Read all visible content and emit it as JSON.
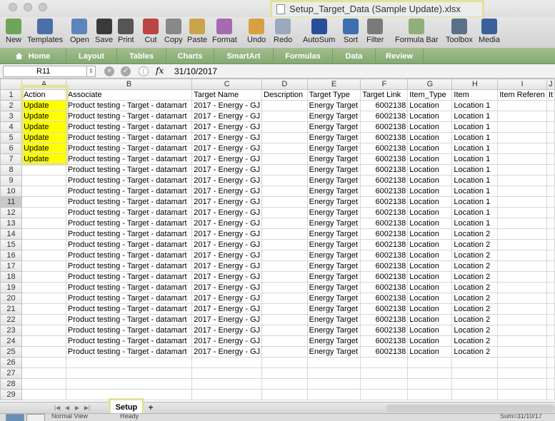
{
  "window": {
    "title": "Setup_Target_Data (Sample Update).xlsx"
  },
  "toolbar": {
    "buttons": [
      {
        "label": "New",
        "icon": "new-document-icon"
      },
      {
        "label": "Templates",
        "icon": "templates-icon"
      },
      {
        "label": "Open",
        "icon": "open-folder-icon"
      },
      {
        "label": "Save",
        "icon": "save-icon"
      },
      {
        "label": "Print",
        "icon": "print-icon"
      },
      {
        "label": "Cut",
        "icon": "scissors-icon"
      },
      {
        "label": "Copy",
        "icon": "copy-icon"
      },
      {
        "label": "Paste",
        "icon": "paste-icon"
      },
      {
        "label": "Format",
        "icon": "format-brush-icon"
      },
      {
        "label": "Undo",
        "icon": "undo-icon"
      },
      {
        "label": "Redo",
        "icon": "redo-icon"
      },
      {
        "label": "AutoSum",
        "icon": "sigma-icon"
      },
      {
        "label": "Sort",
        "icon": "sort-icon"
      },
      {
        "label": "Filter",
        "icon": "filter-icon"
      },
      {
        "label": "Formula Bar",
        "icon": "fx-icon"
      },
      {
        "label": "Toolbox",
        "icon": "toolbox-icon"
      },
      {
        "label": "Media",
        "icon": "media-icon"
      }
    ]
  },
  "ribbon": {
    "tabs": [
      "Home",
      "Layout",
      "Tables",
      "Charts",
      "SmartArt",
      "Formulas",
      "Data",
      "Review"
    ]
  },
  "formula_bar": {
    "name_box": "R11",
    "fx_label": "fx",
    "value": "31/10/2017"
  },
  "sheet": {
    "column_letters": [
      "A",
      "B",
      "C",
      "D",
      "E",
      "F",
      "G",
      "H",
      "I",
      "J"
    ],
    "header_row": [
      "Action",
      "Associate",
      "Target Name",
      "Description",
      "Target Type",
      "Target Link",
      "Item_Type",
      "Item",
      "Item Referen",
      "It"
    ],
    "selected_row": 11,
    "rows": [
      [
        "Update",
        "Product testing - Target - datamart",
        "2017 - Energy - GJ",
        "",
        "Energy Target",
        "6002138",
        "Location",
        "Location 1"
      ],
      [
        "Update",
        "Product testing - Target - datamart",
        "2017 - Energy - GJ",
        "",
        "Energy Target",
        "6002138",
        "Location",
        "Location 1"
      ],
      [
        "Update",
        "Product testing - Target - datamart",
        "2017 - Energy - GJ",
        "",
        "Energy Target",
        "6002138",
        "Location",
        "Location 1"
      ],
      [
        "Update",
        "Product testing - Target - datamart",
        "2017 - Energy - GJ",
        "",
        "Energy Target",
        "6002138",
        "Location",
        "Location 1"
      ],
      [
        "Update",
        "Product testing - Target - datamart",
        "2017 - Energy - GJ",
        "",
        "Energy Target",
        "6002138",
        "Location",
        "Location 1"
      ],
      [
        "Update",
        "Product testing - Target - datamart",
        "2017 - Energy - GJ",
        "",
        "Energy Target",
        "6002138",
        "Location",
        "Location 1"
      ],
      [
        "",
        "Product testing - Target - datamart",
        "2017 - Energy - GJ",
        "",
        "Energy Target",
        "6002138",
        "Location",
        "Location 1"
      ],
      [
        "",
        "Product testing - Target - datamart",
        "2017 - Energy - GJ",
        "",
        "Energy Target",
        "6002138",
        "Location",
        "Location 1"
      ],
      [
        "",
        "Product testing - Target - datamart",
        "2017 - Energy - GJ",
        "",
        "Energy Target",
        "6002138",
        "Location",
        "Location 1"
      ],
      [
        "",
        "Product testing - Target - datamart",
        "2017 - Energy - GJ",
        "",
        "Energy Target",
        "6002138",
        "Location",
        "Location 1"
      ],
      [
        "",
        "Product testing - Target - datamart",
        "2017 - Energy - GJ",
        "",
        "Energy Target",
        "6002138",
        "Location",
        "Location 1"
      ],
      [
        "",
        "Product testing - Target - datamart",
        "2017 - Energy - GJ",
        "",
        "Energy Target",
        "6002138",
        "Location",
        "Location 1"
      ],
      [
        "",
        "Product testing - Target - datamart",
        "2017 - Energy - GJ",
        "",
        "Energy Target",
        "6002138",
        "Location",
        "Location 2"
      ],
      [
        "",
        "Product testing - Target - datamart",
        "2017 - Energy - GJ",
        "",
        "Energy Target",
        "6002138",
        "Location",
        "Location 2"
      ],
      [
        "",
        "Product testing - Target - datamart",
        "2017 - Energy - GJ",
        "",
        "Energy Target",
        "6002138",
        "Location",
        "Location 2"
      ],
      [
        "",
        "Product testing - Target - datamart",
        "2017 - Energy - GJ",
        "",
        "Energy Target",
        "6002138",
        "Location",
        "Location 2"
      ],
      [
        "",
        "Product testing - Target - datamart",
        "2017 - Energy - GJ",
        "",
        "Energy Target",
        "6002138",
        "Location",
        "Location 2"
      ],
      [
        "",
        "Product testing - Target - datamart",
        "2017 - Energy - GJ",
        "",
        "Energy Target",
        "6002138",
        "Location",
        "Location 2"
      ],
      [
        "",
        "Product testing - Target - datamart",
        "2017 - Energy - GJ",
        "",
        "Energy Target",
        "6002138",
        "Location",
        "Location 2"
      ],
      [
        "",
        "Product testing - Target - datamart",
        "2017 - Energy - GJ",
        "",
        "Energy Target",
        "6002138",
        "Location",
        "Location 2"
      ],
      [
        "",
        "Product testing - Target - datamart",
        "2017 - Energy - GJ",
        "",
        "Energy Target",
        "6002138",
        "Location",
        "Location 2"
      ],
      [
        "",
        "Product testing - Target - datamart",
        "2017 - Energy - GJ",
        "",
        "Energy Target",
        "6002138",
        "Location",
        "Location 2"
      ],
      [
        "",
        "Product testing - Target - datamart",
        "2017 - Energy - GJ",
        "",
        "Energy Target",
        "6002138",
        "Location",
        "Location 2"
      ],
      [
        "",
        "Product testing - Target - datamart",
        "2017 - Energy - GJ",
        "",
        "Energy Target",
        "6002138",
        "Location",
        "Location 2"
      ]
    ],
    "empty_rows": 4
  },
  "sheet_tabs": {
    "active": "Setup",
    "add_label": "+"
  },
  "status_bar": {
    "view": "Normal View",
    "state": "Ready",
    "sum": "Sum=31/10/17"
  },
  "colors": {
    "highlight_yellow": "#ffff00",
    "annotation_box": "#e2e29a",
    "ribbon_green": "#8fb07b"
  }
}
